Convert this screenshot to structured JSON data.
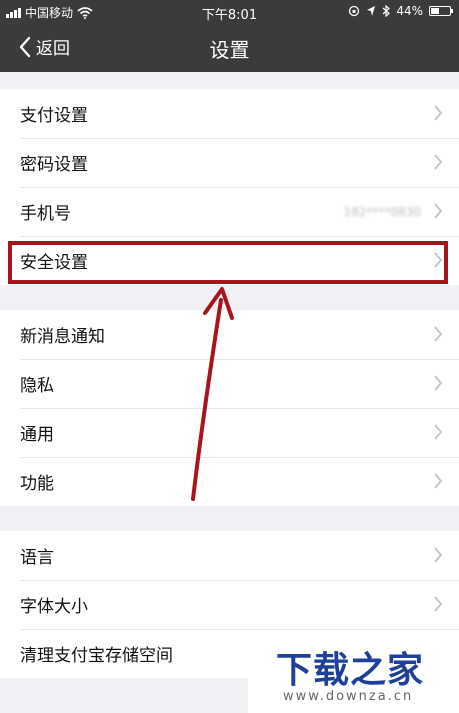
{
  "status_bar": {
    "carrier": "中国移动",
    "time": "下午8:01",
    "battery": "44%",
    "battery_level": 0.44
  },
  "nav": {
    "back_label": "返回",
    "title": "设置"
  },
  "groups": [
    {
      "items": [
        {
          "label": "支付设置"
        },
        {
          "label": "密码设置"
        },
        {
          "label": "手机号",
          "value": "182****0830"
        },
        {
          "label": "安全设置"
        }
      ]
    },
    {
      "items": [
        {
          "label": "新消息通知"
        },
        {
          "label": "隐私"
        },
        {
          "label": "通用"
        },
        {
          "label": "功能"
        }
      ]
    },
    {
      "items": [
        {
          "label": "语言"
        },
        {
          "label": "字体大小"
        },
        {
          "label": "清理支付宝存储空间"
        }
      ]
    }
  ],
  "watermark": {
    "logo": "下载之家",
    "url": "www.downza.cn"
  },
  "colors": {
    "header_bg": "#3b3b3b",
    "highlight": "#a8141b",
    "watermark": "#1f3f9a"
  }
}
